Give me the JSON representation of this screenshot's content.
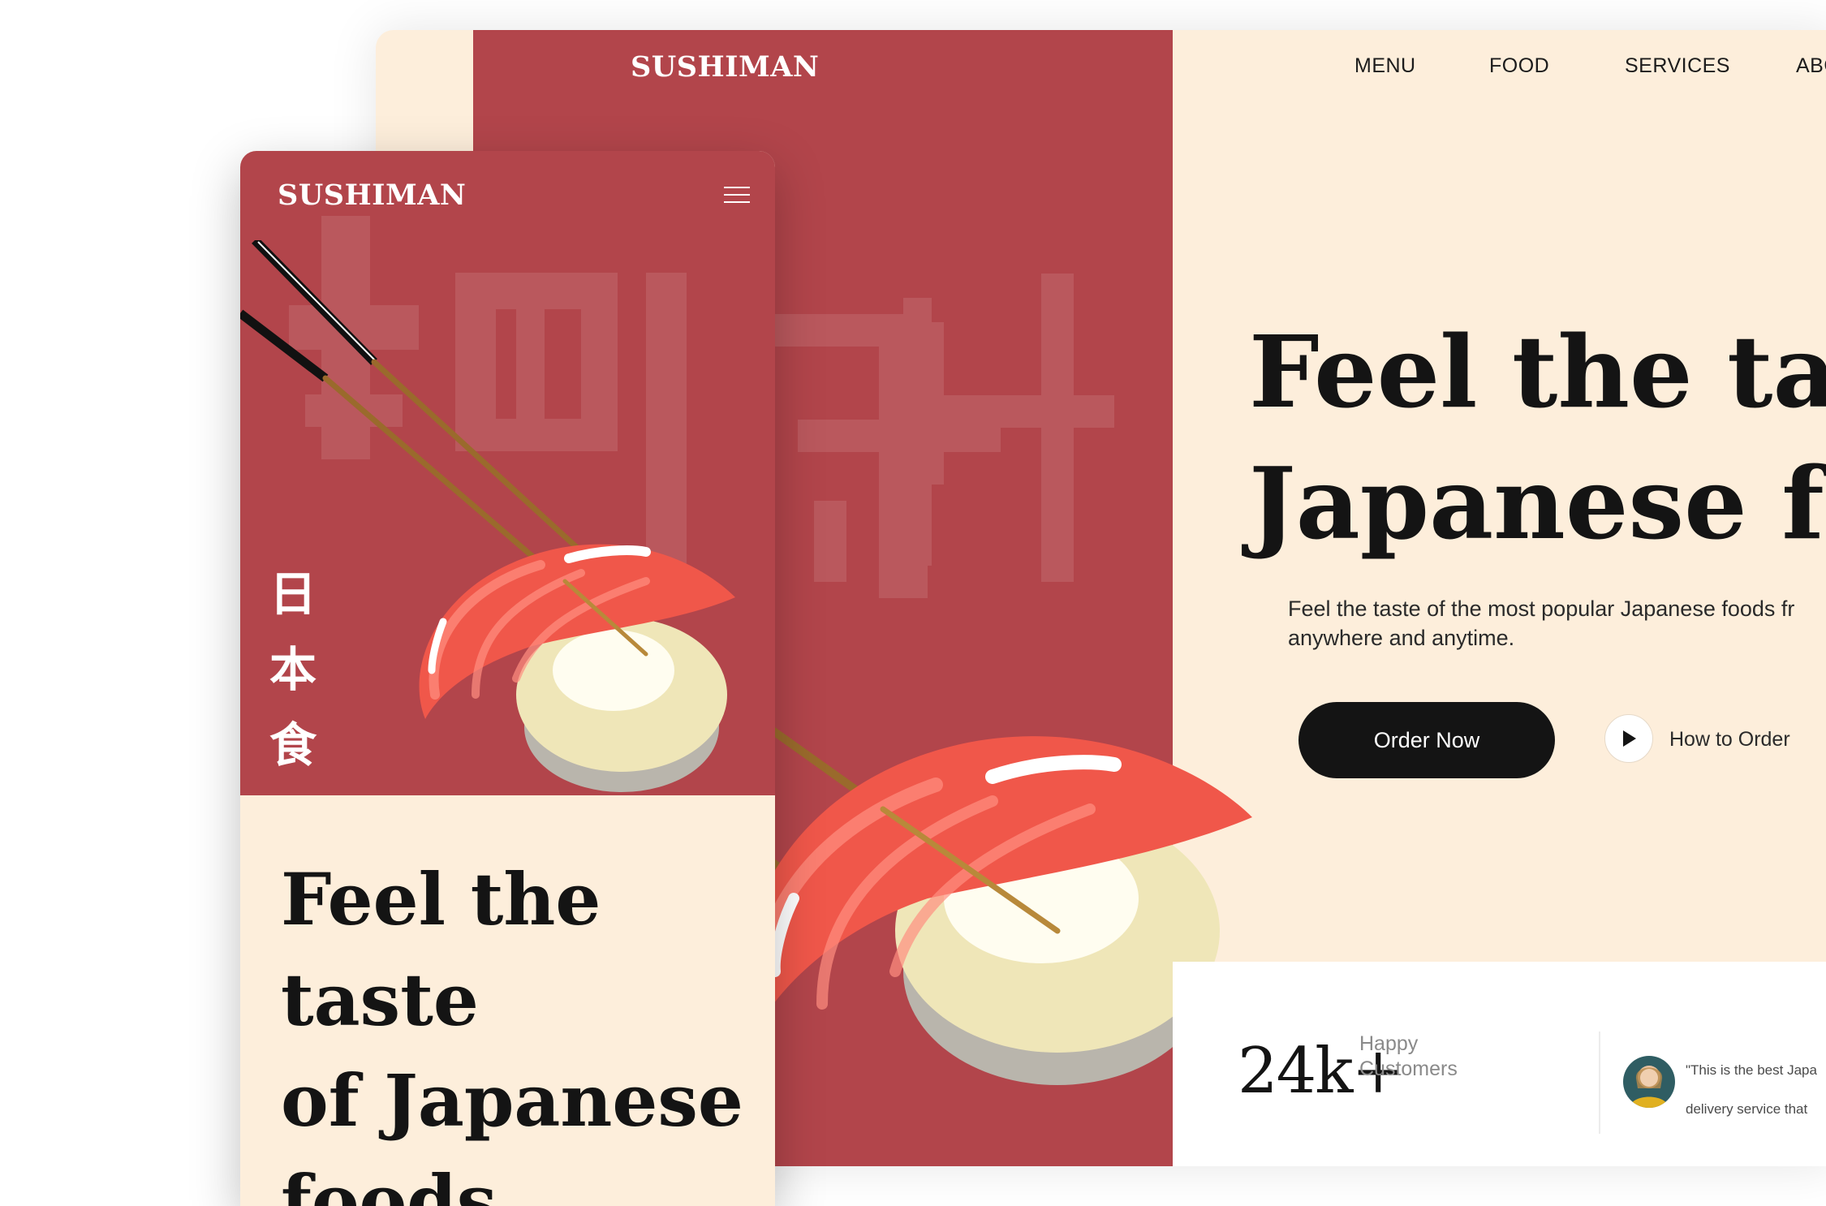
{
  "brand": "SUSHIMAN",
  "desktop": {
    "nav": [
      "MENU",
      "FOOD",
      "SERVICES",
      "ABO"
    ],
    "hero_title_line1": "Feel the taste",
    "hero_title_line2": "Japanese food",
    "hero_subtitle_line1": "Feel the taste of the most popular Japanese foods fr",
    "hero_subtitle_line2": "anywhere and anytime.",
    "order_button": "Order Now",
    "how_to_order": "How to Order",
    "stat_number": "24k+",
    "stat_label_line1": "Happy",
    "stat_label_line2": "Customers",
    "quote_line1": "\"This is the best Japa",
    "quote_line2": "delivery service that"
  },
  "mobile": {
    "kanji": [
      "日",
      "本",
      "食"
    ],
    "title_line1": "Feel the taste",
    "title_line2": "of Japanese",
    "title_line3": "foods"
  },
  "colors": {
    "brand_red": "#b2454b",
    "cream": "#fdeedb",
    "dark": "#141414",
    "salmon": "#f0574a"
  },
  "icons": [
    "hamburger-menu-icon",
    "play-icon",
    "chopsticks-illustration",
    "sushi-illustration",
    "kanji-watermark"
  ]
}
